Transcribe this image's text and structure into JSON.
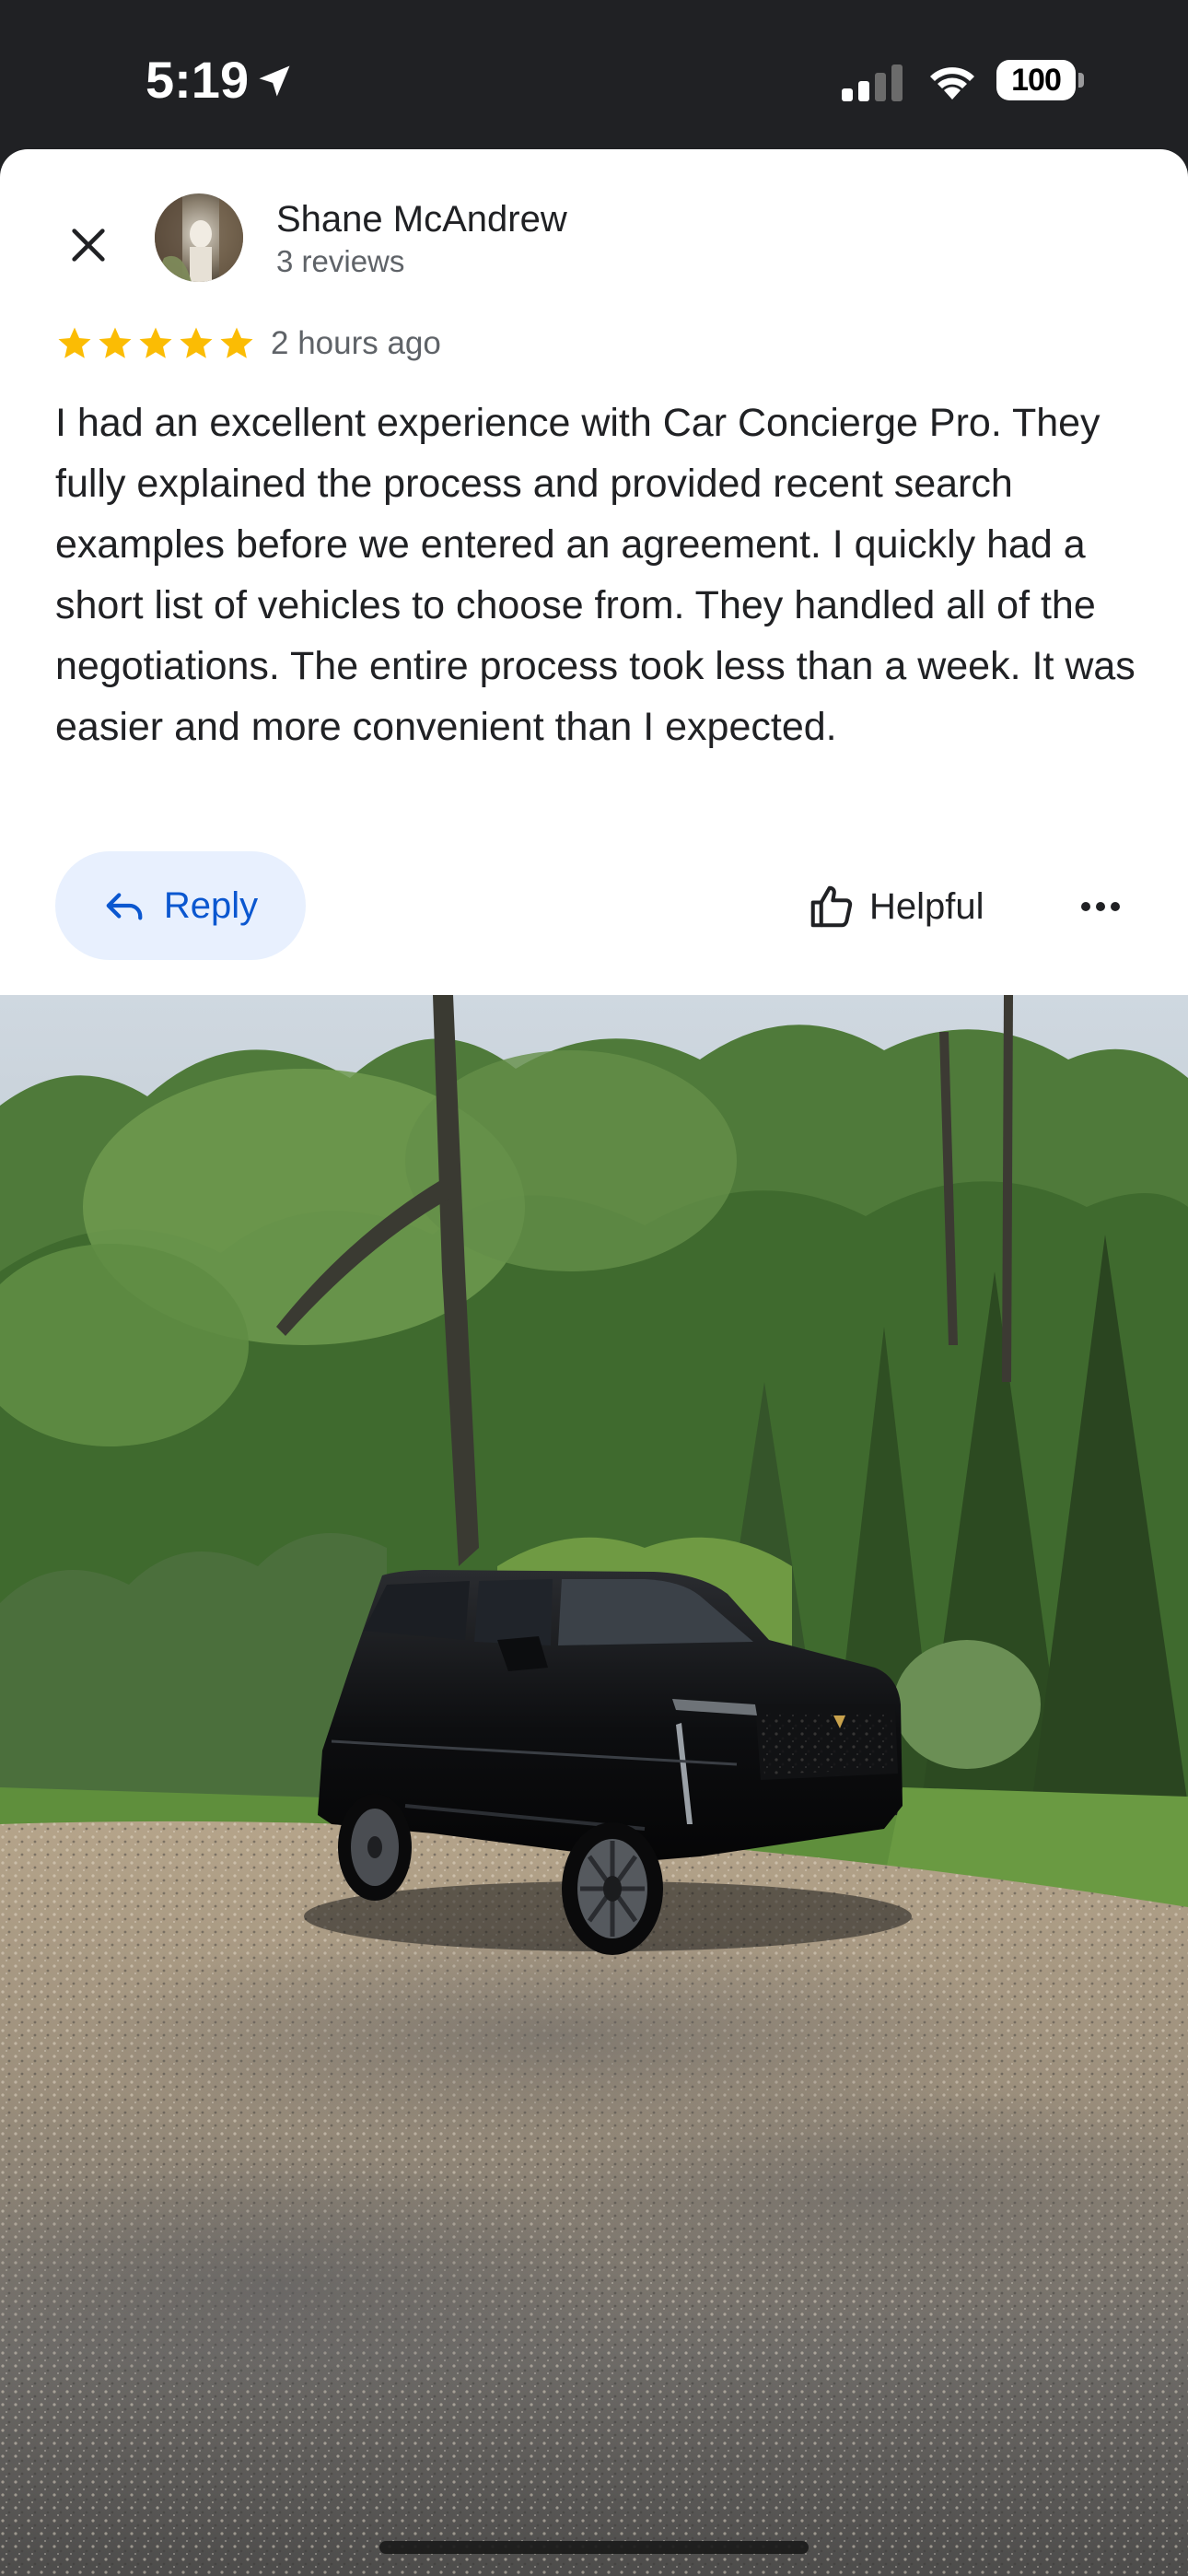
{
  "status_bar": {
    "time": "5:19",
    "battery": "100"
  },
  "review": {
    "reviewer_name": "Shane McAndrew",
    "reviewer_reviews": "3 reviews",
    "rating": 5,
    "rating_max": 5,
    "time_ago": "2 hours ago",
    "text": "I had an excellent experience with Car Concierge Pro. They fully explained the process and provided recent search examples before we entered an agreement. I quickly had a short list of vehicles to choose from. They handled all of the negotiations. The entire process took less than a week. It was easier and more convenient than I expected."
  },
  "actions": {
    "reply_label": "Reply",
    "helpful_label": "Helpful"
  },
  "icons": {
    "close": "close-icon",
    "reply": "reply-arrow-icon",
    "helpful": "thumbs-up-icon",
    "more": "more-horizontal-icon",
    "star": "star-icon"
  },
  "colors": {
    "star": "#fbbc04",
    "reply_bg": "#e8f0fe",
    "reply_text": "#0b57d0",
    "status_bar_bg": "#202124"
  }
}
